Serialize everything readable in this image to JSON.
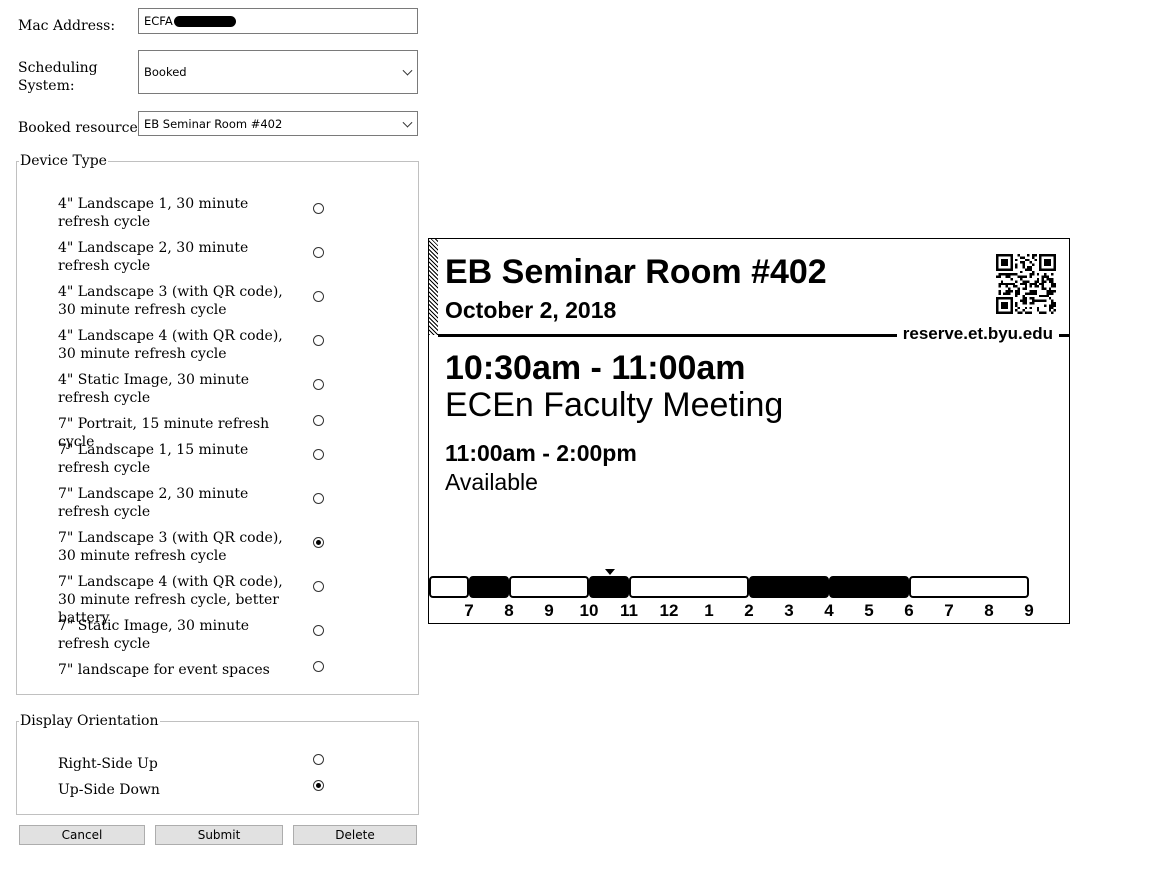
{
  "form": {
    "mac_label": "Mac Address:",
    "mac_value": "ECFA",
    "scheduling_label": "Scheduling System:",
    "scheduling_value": "Booked",
    "resource_label": "Booked resource:",
    "resource_value": "EB Seminar Room #402"
  },
  "device_type": {
    "legend": "Device Type",
    "selected_index": 8,
    "options": [
      "4\" Landscape 1, 30 minute refresh cycle",
      "4\" Landscape 2, 30 minute refresh cycle",
      "4\" Landscape 3 (with QR code), 30 minute refresh cycle",
      "4\" Landscape 4 (with QR code), 30 minute refresh cycle",
      "4\" Static Image, 30 minute refresh cycle",
      "7\" Portrait, 15 minute refresh cycle",
      "7\" Landscape 1, 15 minute refresh cycle",
      "7\" Landscape 2, 30 minute refresh cycle",
      "7\" Landscape 3 (with QR code), 30 minute refresh cycle",
      "7\" Landscape 4 (with QR code), 30 minute refresh cycle, better battery",
      "7\" Static Image, 30 minute refresh cycle",
      "7\" landscape for event spaces"
    ]
  },
  "orientation": {
    "legend": "Display Orientation",
    "selected_index": 1,
    "options": [
      "Right-Side Up",
      "Up-Side Down"
    ]
  },
  "buttons": {
    "cancel": "Cancel",
    "submit": "Submit",
    "delete": "Delete"
  },
  "preview": {
    "room": "EB Seminar Room #402",
    "date": "October 2, 2018",
    "url": "reserve.et.byu.edu",
    "events": [
      {
        "time": "10:30am - 11:00am",
        "name": "ECEn Faculty Meeting"
      },
      {
        "time": "11:00am - 2:00pm",
        "name": "Available"
      }
    ],
    "timeline_hours": [
      "7",
      "8",
      "9",
      "10",
      "11",
      "12",
      "1",
      "2",
      "3",
      "4",
      "5",
      "6",
      "7",
      "8",
      "9"
    ],
    "timeline_segments": [
      {
        "start": 7,
        "end": 8,
        "busy": false
      },
      {
        "start": 8,
        "end": 9,
        "busy": true
      },
      {
        "start": 9,
        "end": 11,
        "busy": false
      },
      {
        "start": 11,
        "end": 12,
        "busy": true
      },
      {
        "start": 12,
        "end": 15,
        "busy": false
      },
      {
        "start": 15,
        "end": 17,
        "busy": true
      },
      {
        "start": 17,
        "end": 19,
        "busy": true
      },
      {
        "start": 19,
        "end": 22,
        "busy": false
      }
    ],
    "current_hour": 11
  }
}
